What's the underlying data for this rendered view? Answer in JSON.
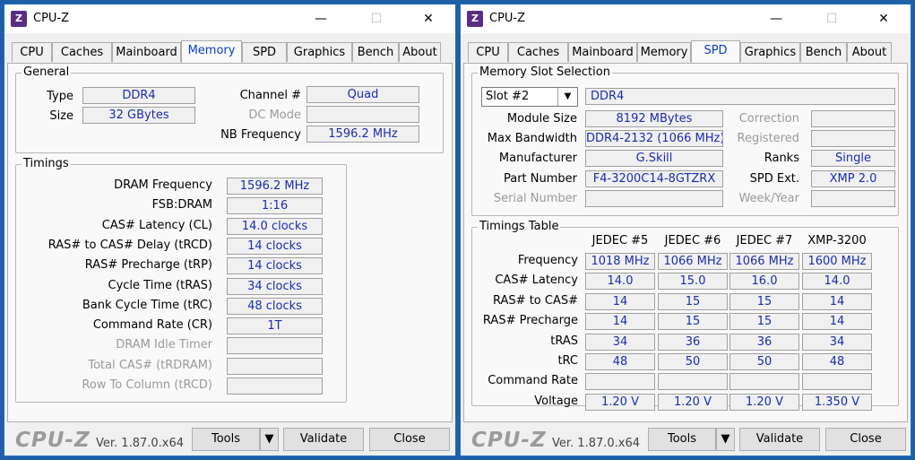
{
  "app": {
    "title": "CPU-Z",
    "icon": "cpu-z-app-icon",
    "logo": "CPU-Z",
    "version": "Ver. 1.87.0.x64",
    "tools_label": "Tools",
    "validate_label": "Validate",
    "close_label": "Close",
    "minimize": "—",
    "maximize": "☐",
    "close_x": "✕"
  },
  "tabs": [
    "CPU",
    "Caches",
    "Mainboard",
    "Memory",
    "SPD",
    "Graphics",
    "Bench",
    "About"
  ],
  "memory": {
    "general_title": "General",
    "type_label": "Type",
    "type_value": "DDR4",
    "size_label": "Size",
    "size_value": "32 GBytes",
    "channel_label": "Channel #",
    "channel_value": "Quad",
    "dcmode_label": "DC Mode",
    "dcmode_value": "",
    "nbfreq_label": "NB Frequency",
    "nbfreq_value": "1596.2 MHz",
    "timings_title": "Timings",
    "timings": [
      {
        "label": "DRAM Frequency",
        "value": "1596.2 MHz",
        "enabled": true
      },
      {
        "label": "FSB:DRAM",
        "value": "1:16",
        "enabled": true
      },
      {
        "label": "CAS# Latency (CL)",
        "value": "14.0 clocks",
        "enabled": true
      },
      {
        "label": "RAS# to CAS# Delay (tRCD)",
        "value": "14 clocks",
        "enabled": true
      },
      {
        "label": "RAS# Precharge (tRP)",
        "value": "14 clocks",
        "enabled": true
      },
      {
        "label": "Cycle Time (tRAS)",
        "value": "34 clocks",
        "enabled": true
      },
      {
        "label": "Bank Cycle Time (tRC)",
        "value": "48 clocks",
        "enabled": true
      },
      {
        "label": "Command Rate (CR)",
        "value": "1T",
        "enabled": true
      },
      {
        "label": "DRAM Idle Timer",
        "value": "",
        "enabled": false
      },
      {
        "label": "Total CAS# (tRDRAM)",
        "value": "",
        "enabled": false
      },
      {
        "label": "Row To Column (tRCD)",
        "value": "",
        "enabled": false
      }
    ]
  },
  "spd": {
    "slot_title": "Memory Slot Selection",
    "slot_value": "Slot #2",
    "slot_type": "DDR4",
    "module_size_label": "Module Size",
    "module_size": "8192 MBytes",
    "max_bw_label": "Max Bandwidth",
    "max_bw": "DDR4-2132 (1066 MHz)",
    "manufacturer_label": "Manufacturer",
    "manufacturer": "G.Skill",
    "part_label": "Part Number",
    "part": "F4-3200C14-8GTZRX",
    "serial_label": "Serial Number",
    "serial": "",
    "correction_label": "Correction",
    "correction": "",
    "registered_label": "Registered",
    "registered": "",
    "ranks_label": "Ranks",
    "ranks": "Single",
    "spdext_label": "SPD Ext.",
    "spdext": "XMP 2.0",
    "week_label": "Week/Year",
    "week": "",
    "table_title": "Timings Table",
    "columns": [
      "JEDEC #5",
      "JEDEC #6",
      "JEDEC #7",
      "XMP-3200"
    ],
    "rows": [
      {
        "label": "Frequency",
        "values": [
          "1018 MHz",
          "1066 MHz",
          "1066 MHz",
          "1600 MHz"
        ]
      },
      {
        "label": "CAS# Latency",
        "values": [
          "14.0",
          "15.0",
          "16.0",
          "14.0"
        ]
      },
      {
        "label": "RAS# to CAS#",
        "values": [
          "14",
          "15",
          "15",
          "14"
        ]
      },
      {
        "label": "RAS# Precharge",
        "values": [
          "14",
          "15",
          "15",
          "14"
        ]
      },
      {
        "label": "tRAS",
        "values": [
          "34",
          "36",
          "36",
          "34"
        ]
      },
      {
        "label": "tRC",
        "values": [
          "48",
          "50",
          "50",
          "48"
        ]
      },
      {
        "label": "Command Rate",
        "values": [
          "",
          "",
          "",
          ""
        ]
      },
      {
        "label": "Voltage",
        "values": [
          "1.20 V",
          "1.20 V",
          "1.20 V",
          "1.350 V"
        ]
      }
    ]
  }
}
